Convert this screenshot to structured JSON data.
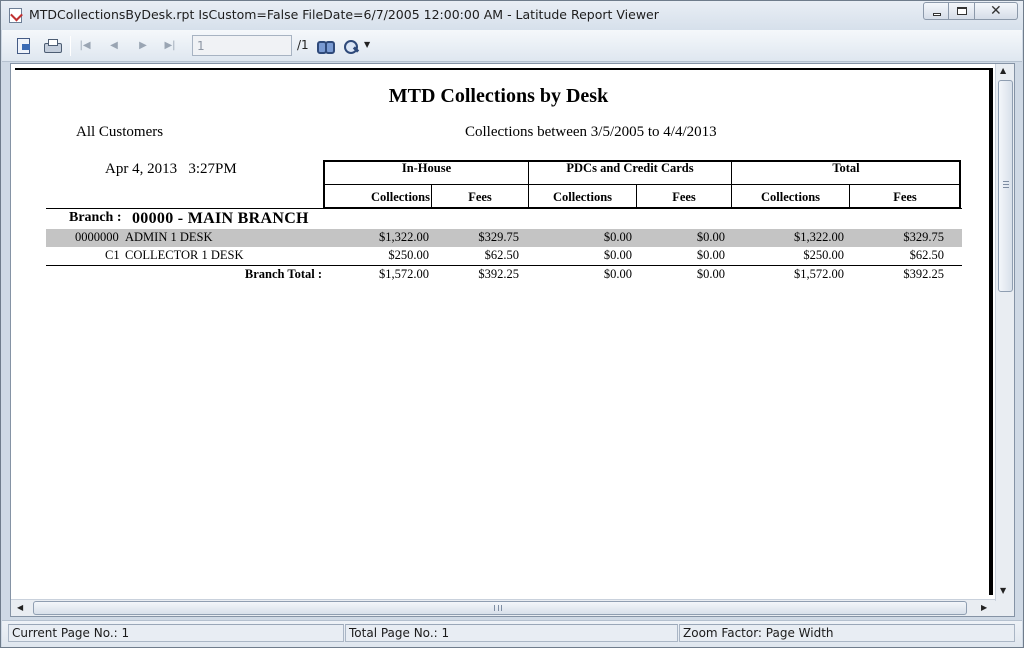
{
  "window": {
    "title": "MTDCollectionsByDesk.rpt IsCustom=False FileDate=6/7/2005 12:00:00 AM - Latitude Report Viewer"
  },
  "toolbar": {
    "page_value": "1",
    "page_total": "/1"
  },
  "report": {
    "title": "MTD Collections by Desk",
    "customers": "All Customers",
    "range": "Collections between 3/5/2005 to 4/4/2013",
    "printed_date": "Apr 4, 2013",
    "printed_time": "3:27PM",
    "groups": [
      {
        "label": "In-House"
      },
      {
        "label": "PDCs and Credit Cards"
      },
      {
        "label": "Total"
      }
    ],
    "subheaders": [
      "Collections",
      "Fees",
      "Collections",
      "Fees",
      "Collections",
      "Fees"
    ],
    "branch_label": "Branch :",
    "branch_name": "00000 - MAIN  BRANCH",
    "rows": [
      {
        "code": "0000000",
        "desk": "ADMIN 1 DESK",
        "values": [
          "$1,322.00",
          "$329.75",
          "$0.00",
          "$0.00",
          "$1,322.00",
          "$329.75"
        ]
      },
      {
        "code": "C1",
        "desk": "COLLECTOR 1 DESK",
        "values": [
          "$250.00",
          "$62.50",
          "$0.00",
          "$0.00",
          "$250.00",
          "$62.50"
        ]
      }
    ],
    "total": {
      "label": "Branch Total :",
      "values": [
        "$1,572.00",
        "$392.25",
        "$0.00",
        "$0.00",
        "$1,572.00",
        "$392.25"
      ]
    }
  },
  "statusbar": {
    "current_page": "Current Page No.: 1",
    "total_page": "Total Page No.: 1",
    "zoom": "Zoom Factor: Page Width"
  }
}
